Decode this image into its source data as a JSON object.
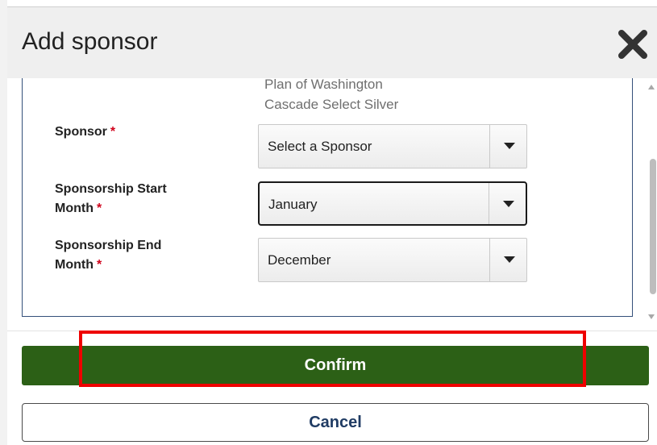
{
  "dialog": {
    "title": "Add sponsor",
    "close_icon": "close-icon"
  },
  "plans": {
    "line1": "Plan of Washington",
    "line2": "Cascade Select Silver"
  },
  "fields": {
    "sponsor": {
      "label": "Sponsor",
      "required_mark": "*",
      "value": "Select a Sponsor"
    },
    "start_month": {
      "label_line1": "Sponsorship Start",
      "label_line2": "Month",
      "required_mark": "*",
      "value": "January"
    },
    "end_month": {
      "label_line1": "Sponsorship End",
      "label_line2": "Month",
      "required_mark": "*",
      "value": "December"
    }
  },
  "actions": {
    "confirm_label": "Confirm",
    "cancel_label": "Cancel"
  },
  "colors": {
    "confirm_bg": "#2c6016",
    "highlight": "#ee0000",
    "required": "#d0021b",
    "cancel_text": "#1f3b63"
  }
}
